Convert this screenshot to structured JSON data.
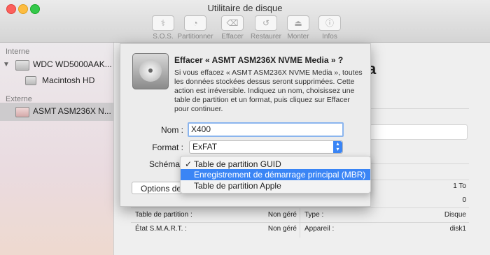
{
  "window": {
    "title": "Utilitaire de disque"
  },
  "toolbar": {
    "buttons": [
      {
        "label": "S.O.S.",
        "icon": "stethoscope-icon"
      },
      {
        "label": "Partitionner",
        "icon": "partition-icon"
      },
      {
        "label": "Effacer",
        "icon": "erase-icon"
      },
      {
        "label": "Restaurer",
        "icon": "restore-icon"
      },
      {
        "label": "Monter",
        "icon": "mount-icon"
      },
      {
        "label": "Infos",
        "icon": "info-icon"
      }
    ]
  },
  "sidebar": {
    "internal_header": "Interne",
    "internal_disk": "WDC WD5000AAK...",
    "internal_volume": "Macintosh HD",
    "external_header": "Externe",
    "external_disk": "ASMT ASM236X N..."
  },
  "main": {
    "header_fragment": "a",
    "options_button": "Options de",
    "right_values": {
      "size": "1 To",
      "count": "0"
    },
    "info_rows": [
      {
        "left_label": "Table de partition :",
        "left_value": "Non géré",
        "right_label": "Type :",
        "right_value": "Disque"
      },
      {
        "left_label": "État S.M.A.R.T. :",
        "left_value": "Non géré",
        "right_label": "Appareil :",
        "right_value": "disk1"
      }
    ]
  },
  "dialog": {
    "title": "Effacer « ASMT ASM236X NVME Media » ?",
    "body": "Si vous effacez « ASMT ASM236X NVME Media », toutes les données stockées dessus seront supprimées. Cette action est irréversible. Indiquez un nom, choisissez une table de partition et un format, puis cliquez sur Effacer pour continuer.",
    "name_label": "Nom :",
    "name_value": "X400",
    "format_label": "Format :",
    "format_value": "ExFAT",
    "scheme_label": "Schéma",
    "scheme_options": [
      {
        "label": "Table de partition GUID",
        "checked": true
      },
      {
        "label": "Enregistrement de démarrage principal (MBR)",
        "highlighted": true
      },
      {
        "label": "Table de partition Apple"
      }
    ],
    "check_mark": "✓"
  },
  "colors": {
    "accent": "#3a85f5",
    "selection": "#cdcbcd"
  }
}
